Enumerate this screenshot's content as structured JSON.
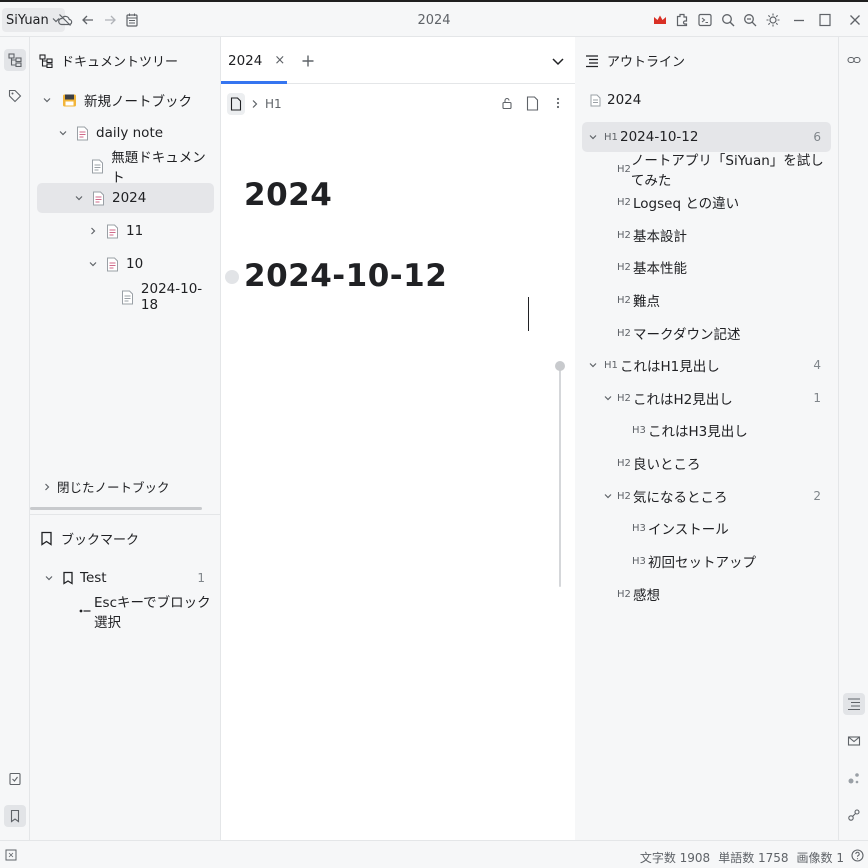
{
  "app": {
    "brand": "SiYuan",
    "title": "2024"
  },
  "filetree": {
    "title": "ドキュメントツリー",
    "rows": [
      {
        "label": "新規ノートブック"
      },
      {
        "label": "daily note"
      },
      {
        "label": "無題ドキュメント"
      },
      {
        "label": "2024"
      },
      {
        "label": "11"
      },
      {
        "label": "10"
      },
      {
        "label": "2024-10-18"
      }
    ],
    "closed_notebooks": "閉じたノートブック"
  },
  "bookmarks": {
    "title": "ブックマーク",
    "group": {
      "label": "Test",
      "count": "1"
    },
    "items": [
      {
        "label": "Escキーでブロック選択"
      }
    ]
  },
  "editor": {
    "tab_label": "2024",
    "tab_close": "×",
    "breadcrumb": "H1",
    "blocks": [
      "2024",
      "2024-10-12"
    ]
  },
  "outline": {
    "title": "アウトライン",
    "doc": "2024",
    "items": [
      {
        "level": "H1",
        "text": "2024-10-12",
        "count": "6"
      },
      {
        "level": "H2",
        "text": "ノートアプリ「SiYuan」を試してみた"
      },
      {
        "level": "H2",
        "text": "Logseq との違い"
      },
      {
        "level": "H2",
        "text": "基本設計"
      },
      {
        "level": "H2",
        "text": "基本性能"
      },
      {
        "level": "H2",
        "text": "難点"
      },
      {
        "level": "H2",
        "text": "マークダウン記述"
      },
      {
        "level": "H1",
        "text": "これはH1見出し",
        "count": "4"
      },
      {
        "level": "H2",
        "text": "これはH2見出し",
        "count": "1"
      },
      {
        "level": "H3",
        "text": "これはH3見出し"
      },
      {
        "level": "H2",
        "text": "良いところ"
      },
      {
        "level": "H2",
        "text": "気になるところ",
        "count": "2"
      },
      {
        "level": "H3",
        "text": "インストール"
      },
      {
        "level": "H3",
        "text": "初回セットアップ"
      },
      {
        "level": "H2",
        "text": "感想"
      }
    ]
  },
  "status": {
    "chars": "文字数 1908",
    "words": "単語数 1758",
    "images": "画像数 1"
  }
}
